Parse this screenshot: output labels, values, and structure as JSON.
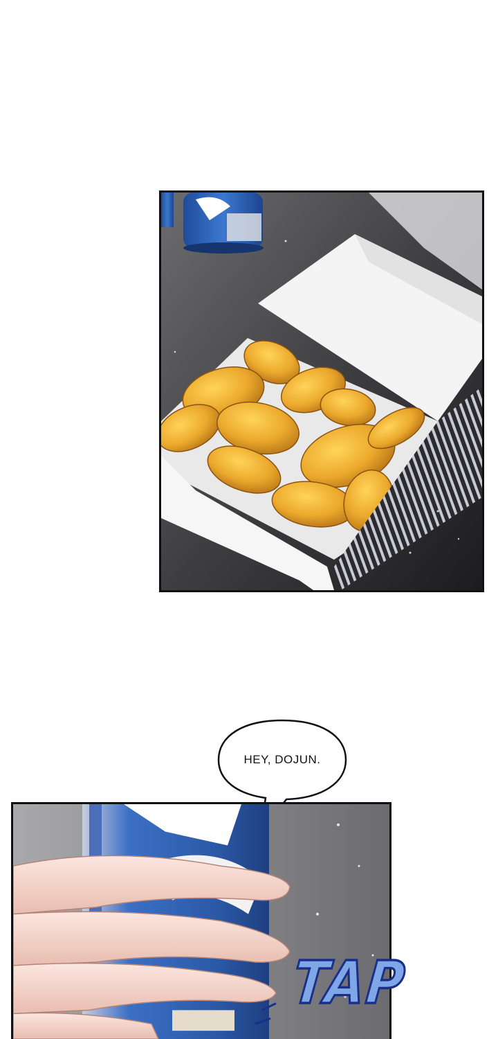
{
  "speech_bubble": {
    "text": "HEY, DOJUN."
  },
  "sound_effect": {
    "text": "TAP",
    "fill_color": "#7fa6e6",
    "outline_color": "#1a2f8a"
  },
  "colors": {
    "background": "#ffffff",
    "panel_border": "#111111",
    "chicken": "#e8a62a",
    "box": "#f2f2f2",
    "can_blue": "#2a5db0",
    "skin": "#f3d6cc"
  }
}
